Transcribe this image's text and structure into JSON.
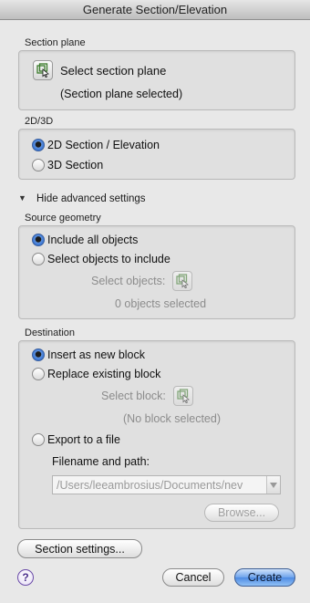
{
  "window": {
    "title": "Generate Section/Elevation"
  },
  "section_plane": {
    "group_label": "Section plane",
    "select_label": "Select section plane",
    "status": "(Section plane selected)"
  },
  "mode": {
    "group_label": "2D/3D",
    "options": [
      {
        "label": "2D Section / Elevation",
        "selected": true
      },
      {
        "label": "3D Section",
        "selected": false
      }
    ]
  },
  "advanced": {
    "toggle_label": "Hide advanced settings"
  },
  "source_geometry": {
    "group_label": "Source geometry",
    "options": [
      {
        "label": "Include all objects",
        "selected": true
      },
      {
        "label": "Select objects to include",
        "selected": false
      }
    ],
    "select_objects_label": "Select objects:",
    "status": "0 objects selected"
  },
  "destination": {
    "group_label": "Destination",
    "options": [
      {
        "label": "Insert as new block",
        "selected": true
      },
      {
        "label": "Replace existing block",
        "selected": false
      },
      {
        "label": "Export to a file",
        "selected": false
      }
    ],
    "select_block_label": "Select block:",
    "block_status": "(No block selected)",
    "filename_label": "Filename and path:",
    "filename_value": "/Users/leeambrosius/Documents/nev",
    "browse_label": "Browse..."
  },
  "footer": {
    "section_settings_label": "Section settings...",
    "help_label": "?",
    "cancel_label": "Cancel",
    "create_label": "Create"
  }
}
